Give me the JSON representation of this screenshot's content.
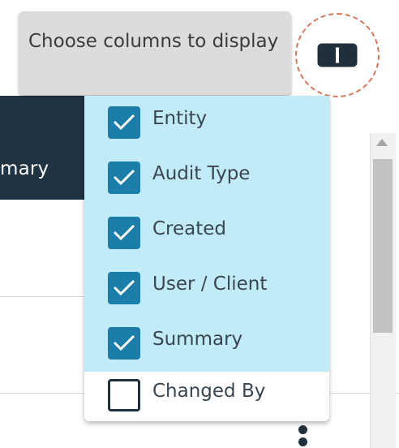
{
  "tooltip": {
    "text": "Choose columns to display"
  },
  "table": {
    "visible_header_fragment": "mary"
  },
  "column_menu": {
    "items": [
      {
        "label": "Entity",
        "checked": true
      },
      {
        "label": "Audit Type",
        "checked": true
      },
      {
        "label": "Created",
        "checked": true
      },
      {
        "label": "User / Client",
        "checked": true
      },
      {
        "label": "Summary",
        "checked": true
      },
      {
        "label": "Changed By",
        "checked": false
      }
    ]
  },
  "icons": {
    "columns_button": "columns-icon",
    "check": "check-icon",
    "row_menu": "more-vertical-icon",
    "scroll_up": "scroll-up-arrow-icon"
  },
  "colors": {
    "header_background": "#203343",
    "menu_checked_background": "#c1ecf7",
    "checkbox_checked": "#1b7ea8",
    "tooltip_background": "#dcdcdc",
    "focus_ring": "#d8745a"
  }
}
